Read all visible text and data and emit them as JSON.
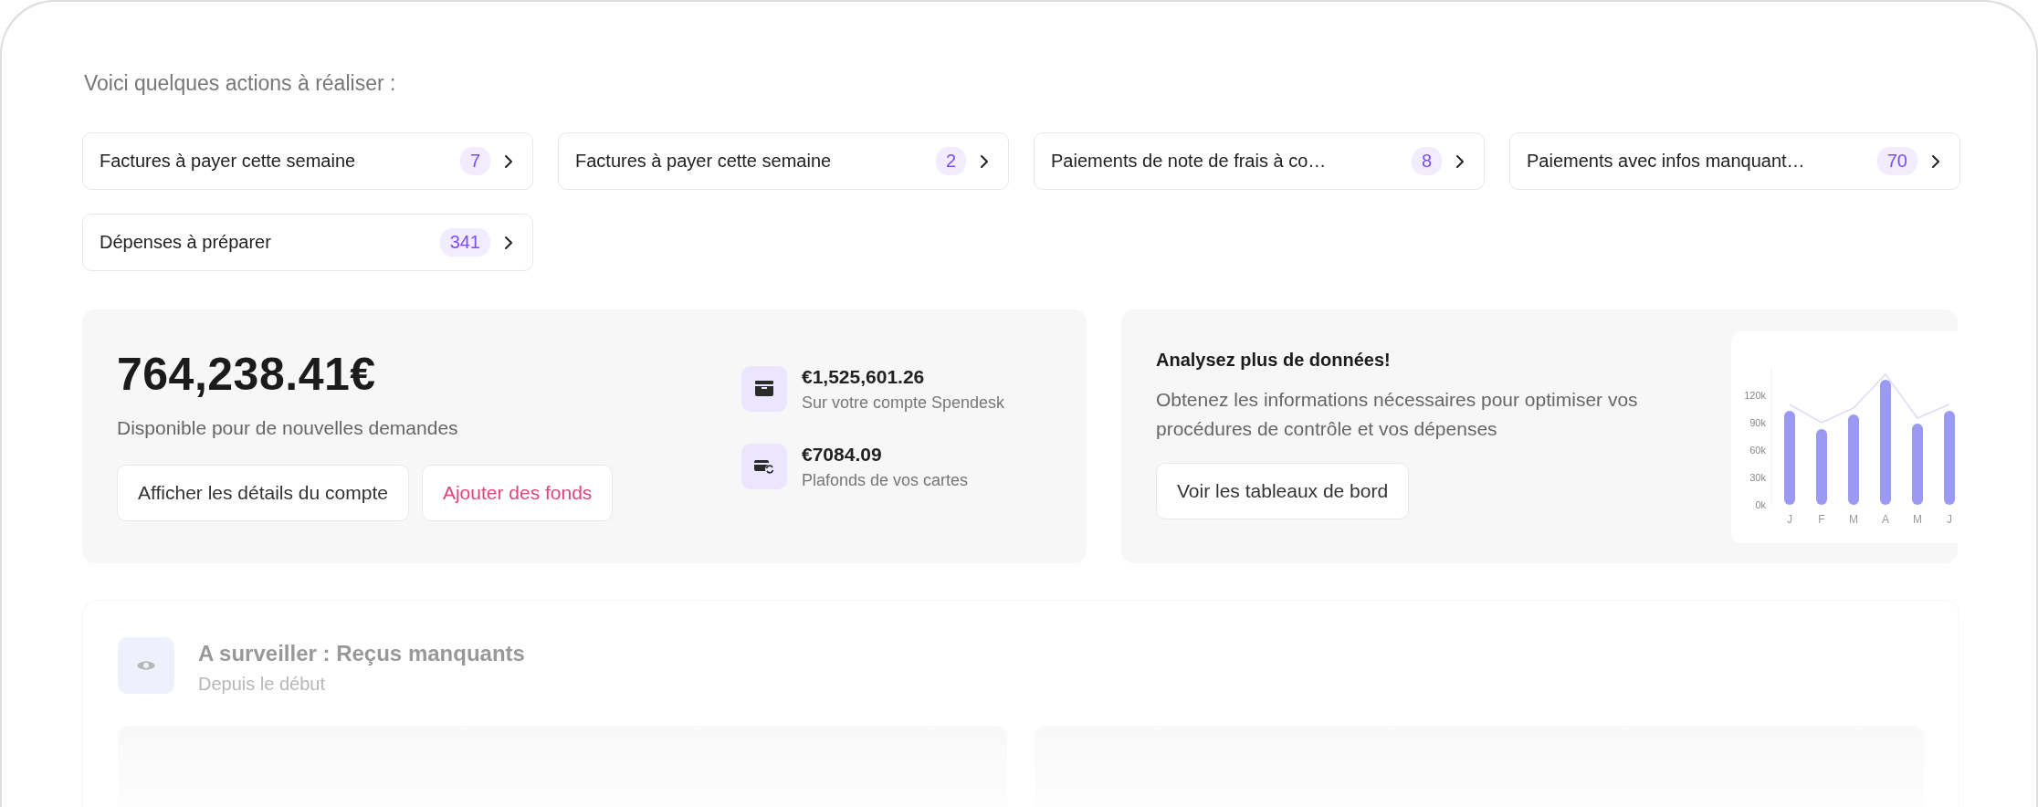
{
  "heading": "Voici quelques actions à réaliser :",
  "actions": [
    {
      "label": "Factures à payer cette semaine",
      "count": "7"
    },
    {
      "label": "Factures à payer cette semaine",
      "count": "2"
    },
    {
      "label": "Paiements de note de frais à co…",
      "count": "8"
    },
    {
      "label": "Paiements avec infos manquant…",
      "count": "70"
    },
    {
      "label": "Dépenses à préparer",
      "count": "341"
    }
  ],
  "balance": {
    "amount": "764,238.41€",
    "caption": "Disponible pour de nouvelles demandes",
    "buttons": [
      {
        "label": "Afficher les détails du compte",
        "kind": "default"
      },
      {
        "label": "Ajouter des fonds",
        "kind": "accent"
      }
    ],
    "accounts": [
      {
        "kind": "wallet",
        "amount": "€1,525,601.26",
        "caption": "Sur votre compte Spendesk"
      },
      {
        "kind": "cards",
        "amount": "€7084.09",
        "caption": "Plafonds de vos cartes"
      }
    ]
  },
  "promo": {
    "title": "Analysez plus de données!",
    "text": "Obtenez les informations nécessaires pour optimiser vos procédures de contrôle et vos dépenses",
    "button": "Voir les tableaux de bord",
    "chart_data": {
      "type": "bar",
      "categories": [
        "J",
        "F",
        "M",
        "A",
        "M",
        "J"
      ],
      "ylim": [
        0,
        150
      ],
      "yticks": [
        {
          "value": 0,
          "label": "0k"
        },
        {
          "value": 30,
          "label": "30k"
        },
        {
          "value": 60,
          "label": "60k"
        },
        {
          "value": 90,
          "label": "90k"
        },
        {
          "value": 120,
          "label": "120k"
        }
      ],
      "series": [
        {
          "type": "bar",
          "color": "#9b9af2",
          "values": [
            103,
            83,
            99,
            137,
            89,
            103
          ]
        },
        {
          "type": "line",
          "color": "#dcdcfa",
          "values": [
            110,
            90,
            106,
            143,
            95,
            110
          ]
        }
      ]
    }
  },
  "watch": {
    "title": "A surveiller : Reçus manquants",
    "subtitle": "Depuis le début"
  }
}
